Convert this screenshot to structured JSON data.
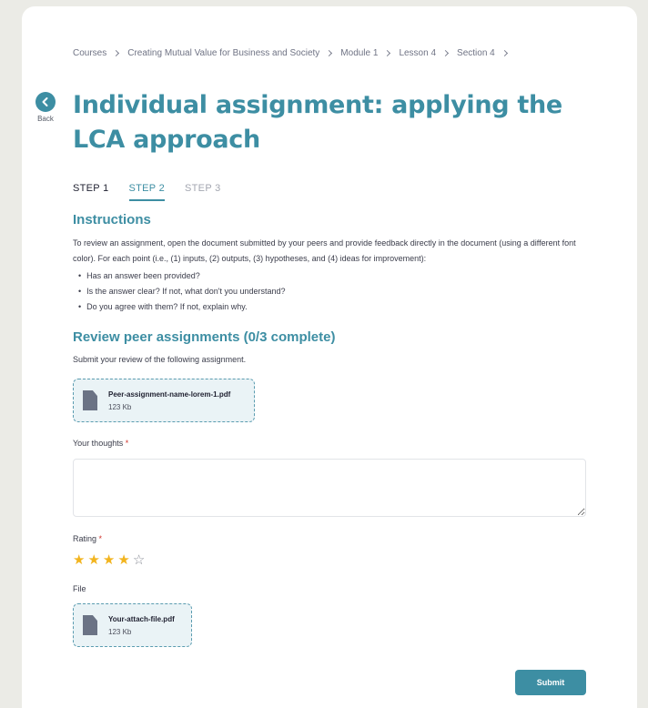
{
  "breadcrumb": [
    {
      "label": "Courses"
    },
    {
      "label": "Creating Mutual Value for Business and Society"
    },
    {
      "label": "Module 1"
    },
    {
      "label": "Lesson 4"
    },
    {
      "label": "Section 4"
    }
  ],
  "back": {
    "label": "Back"
  },
  "page": {
    "title": "Individual assignment: applying the LCA approach"
  },
  "steps": [
    {
      "label": "STEP 1",
      "state": "done"
    },
    {
      "label": "STEP 2",
      "state": "active"
    },
    {
      "label": "STEP 3",
      "state": "todo"
    }
  ],
  "instructions": {
    "heading": "Instructions",
    "text": "To review an assignment, open the document submitted by your peers and provide feedback directly in the document (using a different font color). For each point (i.e., (1) inputs, (2) outputs, (3) hypotheses, and (4) ideas for improvement):",
    "bullets": [
      "Has an answer been provided?",
      "Is the answer clear? If not, what don't you understand?",
      "Do you agree with them? If not, explain why."
    ]
  },
  "review": {
    "heading": "Review peer assignments (0/3 complete)",
    "subtext": "Submit your review of the following assignment.",
    "peer_file": {
      "name": "Peer-assignment-name-lorem-1.pdf",
      "size": "123 Kb",
      "icon": "file-icon"
    }
  },
  "form": {
    "thoughts_label": "Your thoughts",
    "thoughts_value": "",
    "rating_label": "Rating",
    "rating_value": 4,
    "rating_max": 5,
    "required_mark": "*",
    "file_label": "File",
    "attached_file": {
      "name": "Your-attach-file.pdf",
      "size": "123 Kb",
      "icon": "file-icon"
    },
    "submit_label": "Submit"
  },
  "colors": {
    "accent": "#3d8ea3",
    "star": "#f2b41e",
    "required": "#d0342c"
  }
}
